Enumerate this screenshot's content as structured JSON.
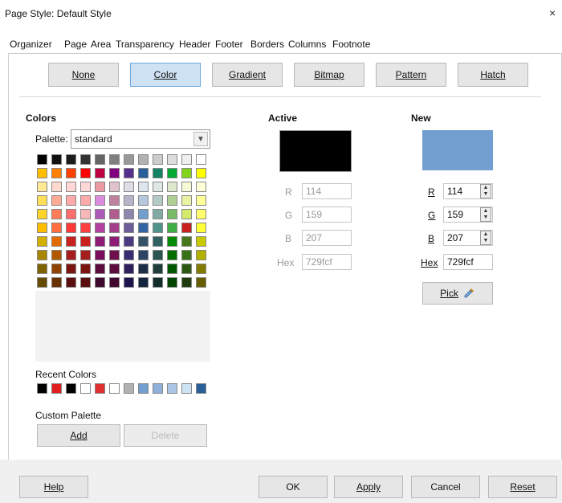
{
  "window": {
    "title": "Page Style: Default Style",
    "close_glyph": "×"
  },
  "tabs": [
    {
      "label": "Organizer",
      "active": false
    },
    {
      "label": "Page",
      "active": false
    },
    {
      "label": "Area",
      "active": true
    },
    {
      "label": "Transparency",
      "active": false
    },
    {
      "label": "Header",
      "active": false
    },
    {
      "label": "Footer",
      "active": false
    },
    {
      "label": "Borders",
      "active": false
    },
    {
      "label": "Columns",
      "active": false
    },
    {
      "label": "Footnote",
      "active": false
    }
  ],
  "fill_types": [
    {
      "label": "None",
      "selected": false
    },
    {
      "label": "Color",
      "selected": true
    },
    {
      "label": "Gradient",
      "selected": false
    },
    {
      "label": "Bitmap",
      "selected": false
    },
    {
      "label": "Pattern",
      "selected": false
    },
    {
      "label": "Hatch",
      "selected": false
    }
  ],
  "colors_section": {
    "title": "Colors",
    "palette_label": "Palette:",
    "palette_value": "standard",
    "recent_label": "Recent Colors",
    "custom_label": "Custom Palette",
    "add_label": "Add",
    "delete_label": "Delete"
  },
  "palette_rows": [
    [
      "#000000",
      "#111111",
      "#1c1c1c",
      "#333333",
      "#666666",
      "#808080",
      "#999999",
      "#b2b2b2",
      "#cccccc",
      "#dddddd",
      "#eeeeee",
      "#ffffff"
    ],
    [
      "#ffbf00",
      "#ff8000",
      "#ff4000",
      "#ff0000",
      "#bf0041",
      "#800080",
      "#55308d",
      "#2a6099",
      "#158466",
      "#00a933",
      "#81d41a",
      "#ffff00"
    ],
    [
      "#ffe994",
      "#ffd8ce",
      "#ffd7d7",
      "#ffd7d7",
      "#ec9ba4",
      "#e0c2cd",
      "#dedce6",
      "#dee6ef",
      "#dee7e5",
      "#dde8cb",
      "#f6f9d4",
      "#ffffd7"
    ],
    [
      "#ffde59",
      "#ffaa95",
      "#ffaaaa",
      "#ffaaaa",
      "#dc8cde",
      "#bf819e",
      "#b7b3ca",
      "#b4c7dc",
      "#b3cac7",
      "#afd095",
      "#e8f2a1",
      "#ffff99"
    ],
    [
      "#ffd428",
      "#ff7b59",
      "#ff6d6d",
      "#f7b7b7",
      "#ad5bb8",
      "#b05c8f",
      "#8e86ae",
      "#729fcf",
      "#81aca6",
      "#77bc65",
      "#d4ea6b",
      "#ffff6d"
    ],
    [
      "#ffbf00",
      "#ff6e3f",
      "#ff3838",
      "#ff4040",
      "#b2429e",
      "#a33e8b",
      "#6b5e9b",
      "#3465a4",
      "#50938a",
      "#3faf46",
      "#c9211e",
      "#ffff38"
    ],
    [
      "#d3b000",
      "#e36a00",
      "#c9211e",
      "#c9211e",
      "#8d1d75",
      "#8d1d75",
      "#4c3b80",
      "#355269",
      "#306060",
      "#008b00",
      "#48761b",
      "#c8c800"
    ],
    [
      "#aa8600",
      "#b25800",
      "#a51d1d",
      "#a51d1d",
      "#7b0e5c",
      "#710e4e",
      "#3a2b72",
      "#2c4566",
      "#2a5553",
      "#006f00",
      "#397117",
      "#b1b100"
    ],
    [
      "#806100",
      "#8e4300",
      "#7a1512",
      "#7a1512",
      "#5c0c3d",
      "#5c0c3d",
      "#2f1f5f",
      "#1c2d47",
      "#1f3d3b",
      "#005900",
      "#2d5812",
      "#837b00"
    ],
    [
      "#654c00",
      "#683100",
      "#5c0f0f",
      "#5c0f0f",
      "#40092f",
      "#410930",
      "#20144f",
      "#12243e",
      "#112e2b",
      "#004600",
      "#1e3c0d",
      "#665c00"
    ]
  ],
  "recent_colors": [
    "#000000",
    "#e02020",
    "#000000",
    "#ffffff",
    "#e03030",
    "#ffffff",
    "#b2b2b2",
    "#729fcf",
    "#8fb0d8",
    "#a9c6e6",
    "#cde4f4",
    "#2a6099"
  ],
  "active": {
    "title": "Active",
    "color": "#000000",
    "r_label": "R",
    "r_value": "114",
    "g_label": "G",
    "g_value": "159",
    "b_label": "B",
    "b_value": "207",
    "hex_label": "Hex",
    "hex_value": "729fcf"
  },
  "new": {
    "title": "New",
    "color": "#729fcf",
    "r_label": "R",
    "r_value": "114",
    "g_label": "G",
    "g_value": "159",
    "b_label": "B",
    "b_value": "207",
    "hex_label": "Hex",
    "hex_value": "729fcf",
    "pick_label": "Pick",
    "pick_icon": "eyedropper-icon"
  },
  "footer": {
    "help_label": "Help",
    "ok_label": "OK",
    "apply_label": "Apply",
    "cancel_label": "Cancel",
    "reset_label": "Reset"
  }
}
